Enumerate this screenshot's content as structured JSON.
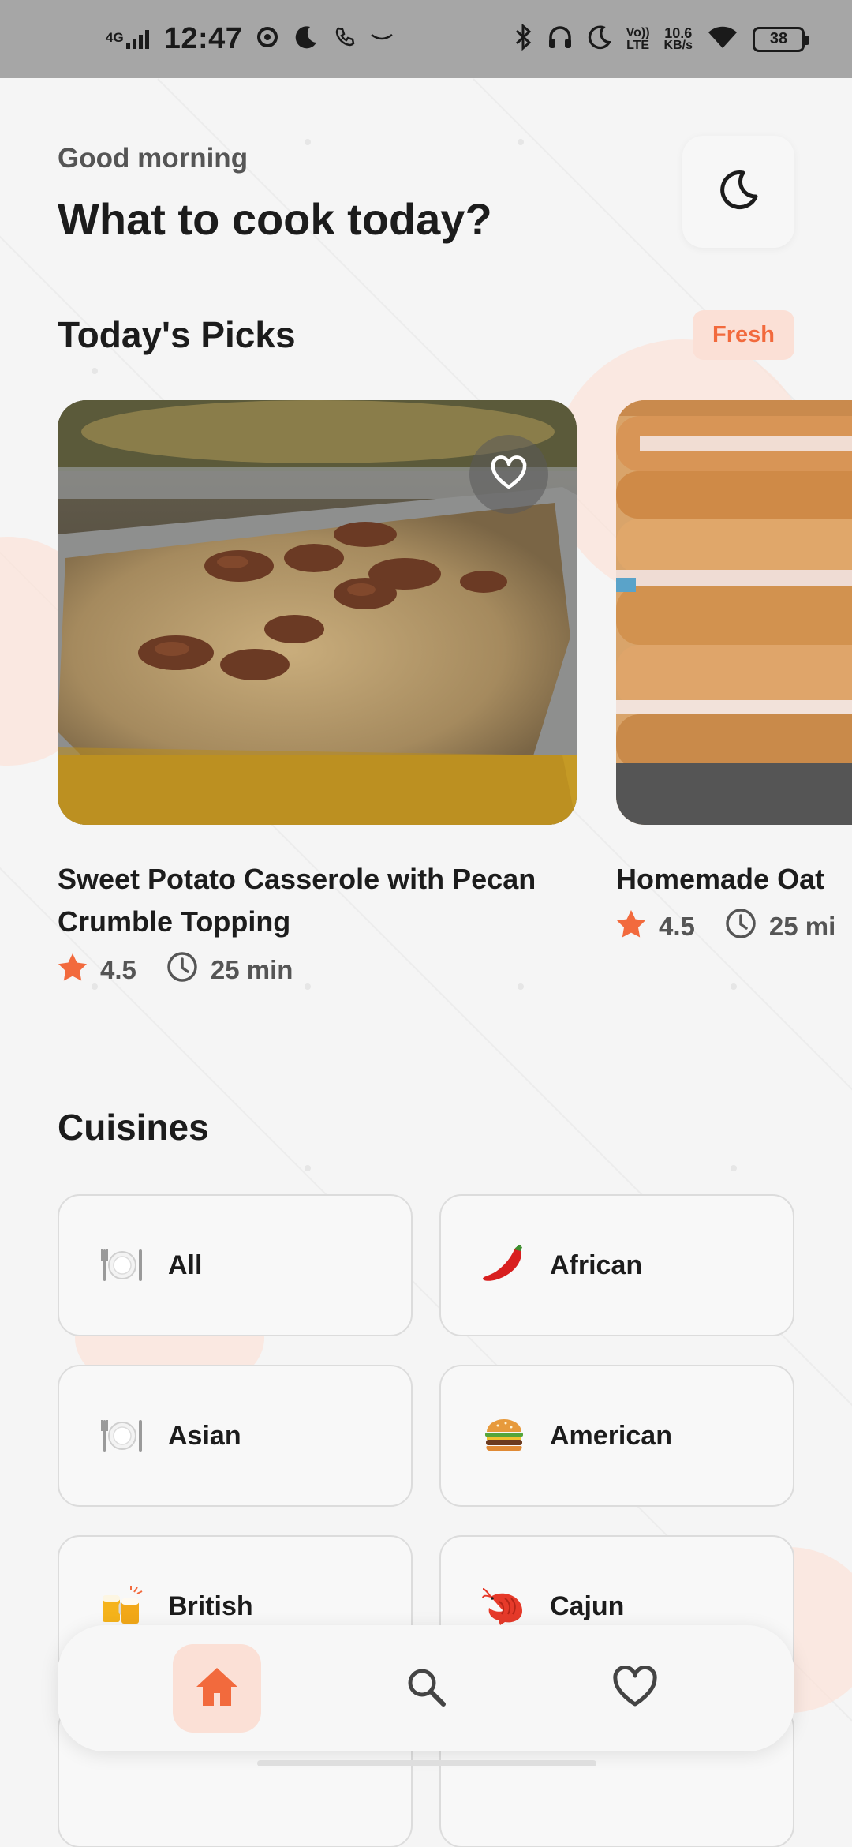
{
  "status_bar": {
    "network": "4G",
    "time": "12:47",
    "speed_value": "10.6",
    "speed_unit": "KB/s",
    "volte_top": "Vo))",
    "volte_bottom": "LTE",
    "battery": "38"
  },
  "header": {
    "greeting": "Good morning",
    "headline": "What to cook today?",
    "theme_toggle_icon": "moon-icon"
  },
  "picks": {
    "title": "Today's Picks",
    "badge": "Fresh",
    "accent_color": "#f26a3d",
    "cards": [
      {
        "title": "Sweet Potato Casserole with Pecan Crumble Topping",
        "rating": "4.5",
        "time": "25 min"
      },
      {
        "title": "Homemade Oat",
        "rating": "4.5",
        "time": "25 mi"
      }
    ]
  },
  "cuisines": {
    "title": "Cuisines",
    "items": [
      {
        "label": "All",
        "icon": "plate-icon"
      },
      {
        "label": "African",
        "icon": "chili-icon"
      },
      {
        "label": "Asian",
        "icon": "plate-icon"
      },
      {
        "label": "American",
        "icon": "burger-icon"
      },
      {
        "label": "British",
        "icon": "beer-icon"
      },
      {
        "label": "Cajun",
        "icon": "shrimp-icon"
      }
    ]
  },
  "bottom_nav": {
    "items": [
      {
        "icon": "home-icon",
        "active": true
      },
      {
        "icon": "search-icon",
        "active": false
      },
      {
        "icon": "heart-icon",
        "active": false
      }
    ]
  }
}
